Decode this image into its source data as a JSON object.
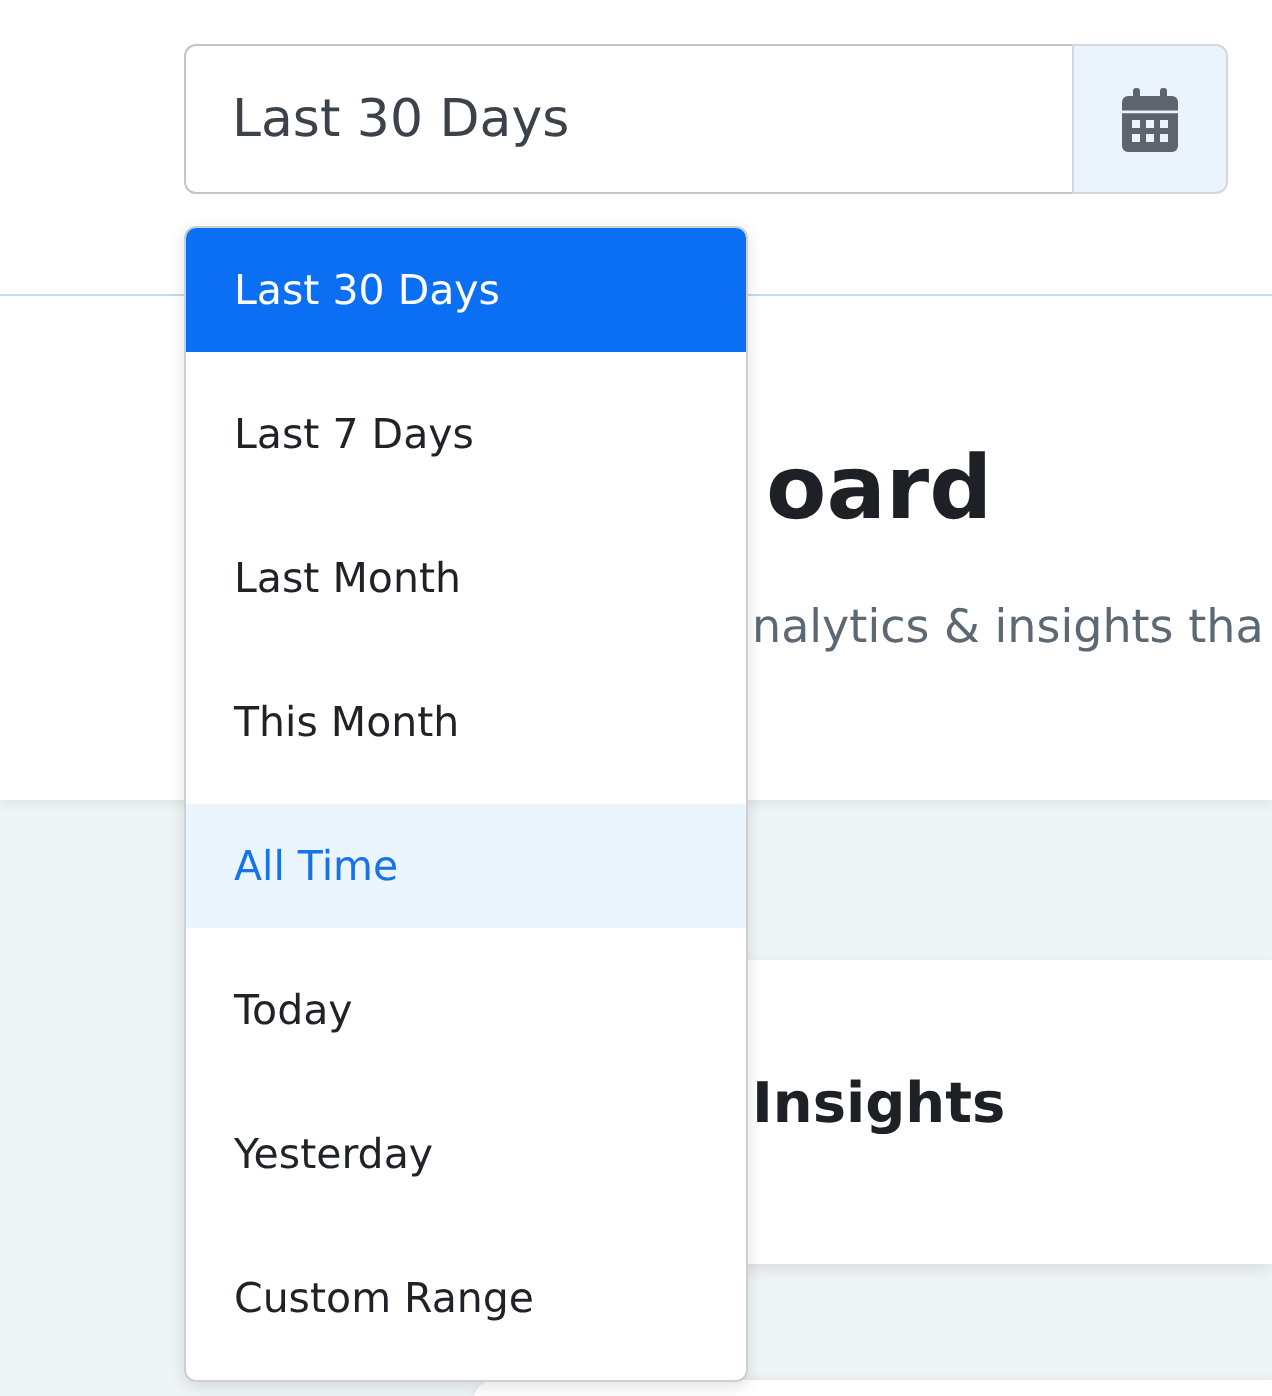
{
  "date_range": {
    "value": "Last 30 Days"
  },
  "dropdown": {
    "options": [
      {
        "label": "Last 30 Days",
        "selected": true,
        "highlighted": false
      },
      {
        "label": "Last 7 Days",
        "selected": false,
        "highlighted": false
      },
      {
        "label": "Last Month",
        "selected": false,
        "highlighted": false
      },
      {
        "label": "This Month",
        "selected": false,
        "highlighted": false
      },
      {
        "label": "All Time",
        "selected": false,
        "highlighted": true
      },
      {
        "label": "Today",
        "selected": false,
        "highlighted": false
      },
      {
        "label": "Yesterday",
        "selected": false,
        "highlighted": false
      },
      {
        "label": "Custom Range",
        "selected": false,
        "highlighted": false
      }
    ]
  },
  "header": {
    "title": "oard",
    "subtitle": "nalytics & insights tha"
  },
  "cards": [
    {
      "title": "Insights"
    }
  ]
}
